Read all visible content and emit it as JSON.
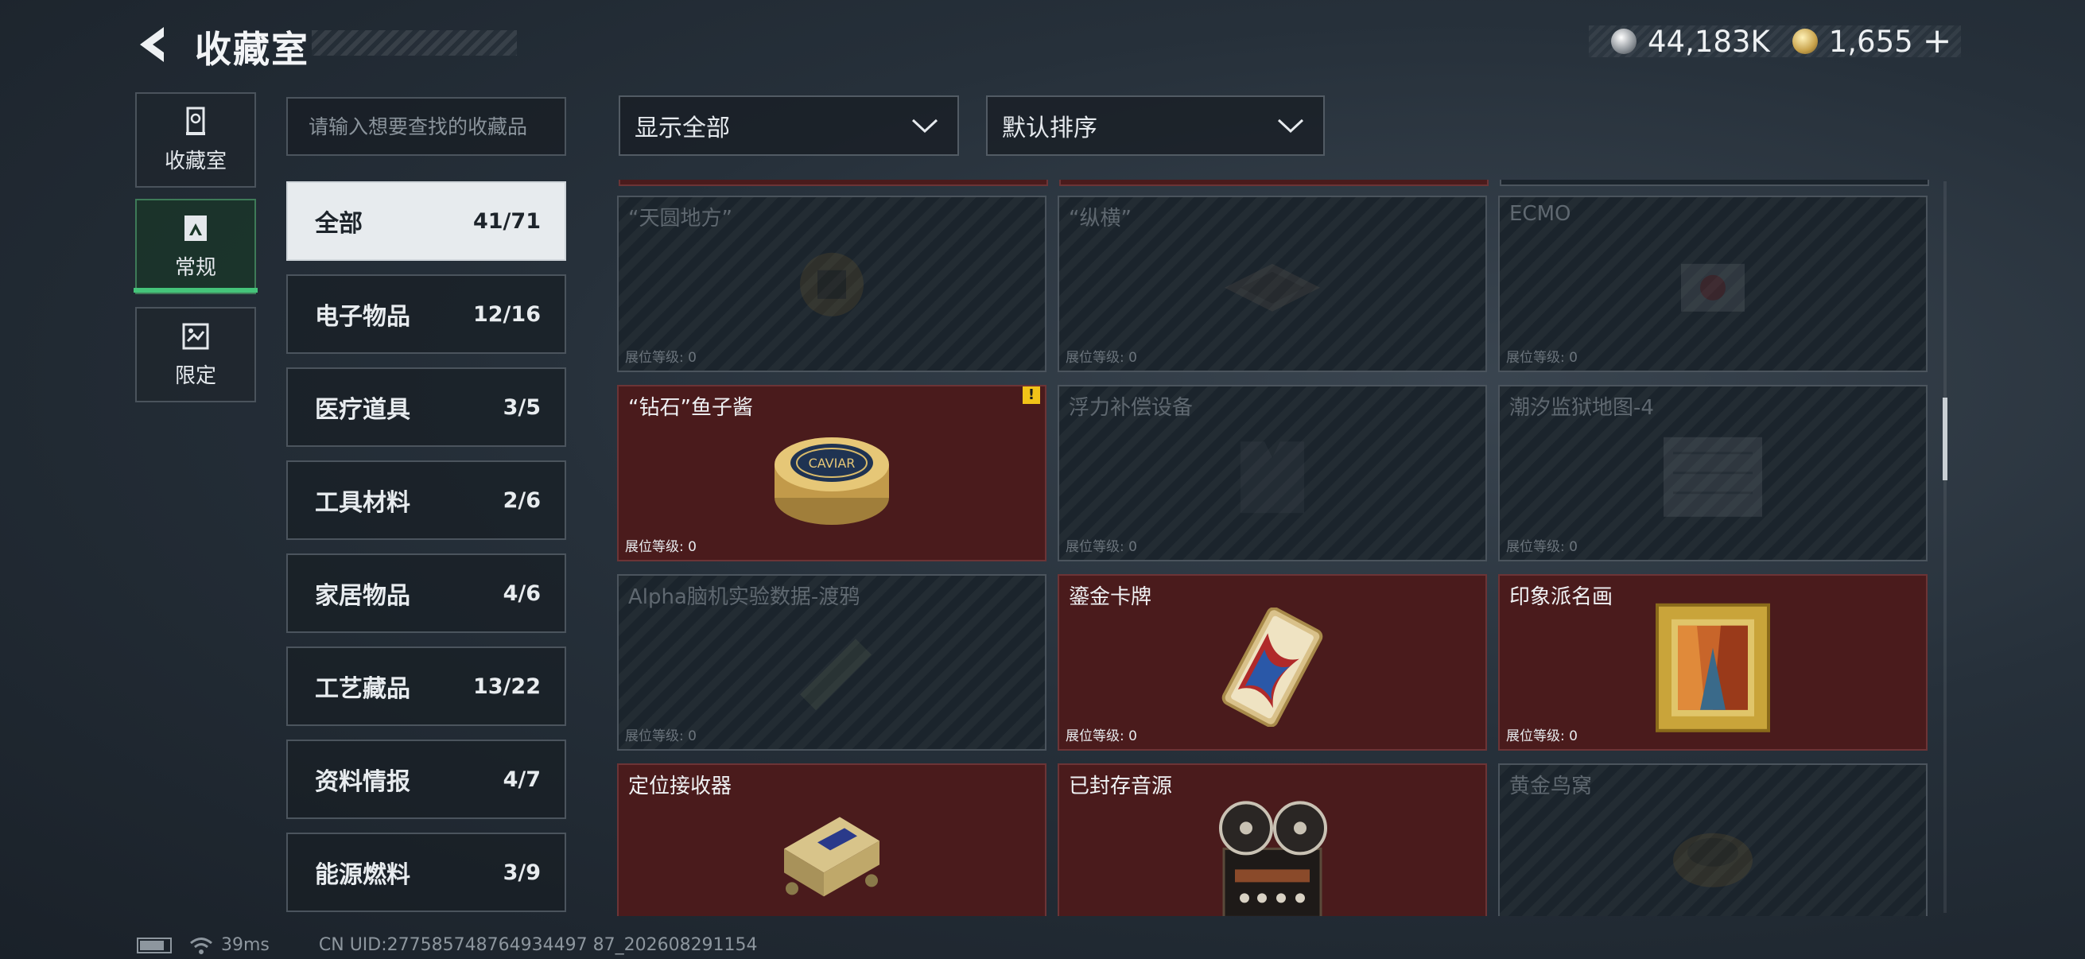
{
  "header": {
    "title": "收藏室"
  },
  "currency": {
    "silver": "44,183K",
    "gold": "1,655"
  },
  "nav": [
    {
      "label": "收藏室",
      "icon": "trophy-case-icon"
    },
    {
      "label": "常规",
      "icon": "picture-icon"
    },
    {
      "label": "限定",
      "icon": "limited-icon"
    }
  ],
  "search": {
    "placeholder": "请输入想要查找的收藏品"
  },
  "categories": [
    {
      "name": "全部",
      "count": "41/71"
    },
    {
      "name": "电子物品",
      "count": "12/16"
    },
    {
      "name": "医疗道具",
      "count": "3/5"
    },
    {
      "name": "工具材料",
      "count": "2/6"
    },
    {
      "name": "家居物品",
      "count": "4/6"
    },
    {
      "name": "工艺藏品",
      "count": "13/22"
    },
    {
      "name": "资料情报",
      "count": "4/7"
    },
    {
      "name": "能源燃料",
      "count": "3/9"
    }
  ],
  "filters": {
    "show": "显示全部",
    "sort": "默认排序"
  },
  "level_label": "展位等级: 0",
  "items": [
    {
      "name": "“天圆地方”",
      "owned": false,
      "icon": "compass-plate-icon"
    },
    {
      "name": "“纵横”",
      "owned": false,
      "icon": "board-game-icon"
    },
    {
      "name": "ECMO",
      "owned": false,
      "icon": "ecmo-device-icon"
    },
    {
      "name": "“钻石”鱼子酱",
      "owned": true,
      "icon": "caviar-tin-icon",
      "warning": "!"
    },
    {
      "name": "浮力补偿设备",
      "owned": false,
      "icon": "buoyancy-vest-icon"
    },
    {
      "name": "潮汐监狱地图-4",
      "owned": false,
      "icon": "map-icon"
    },
    {
      "name": "Alpha脑机实验数据-渡鸦",
      "owned": false,
      "icon": "data-drive-icon"
    },
    {
      "name": "鎏金卡牌",
      "owned": true,
      "icon": "gilded-card-icon"
    },
    {
      "name": "印象派名画",
      "owned": true,
      "icon": "painting-icon"
    },
    {
      "name": "定位接收器",
      "owned": true,
      "icon": "receiver-icon"
    },
    {
      "name": "已封存音源",
      "owned": true,
      "icon": "reel-recorder-icon"
    },
    {
      "name": "黄金鸟窝",
      "owned": false,
      "icon": "bird-nest-icon"
    }
  ],
  "footer": {
    "ping": "39ms",
    "uid": "CN UID:277585748764934497 87_202608291154"
  },
  "colors": {
    "owned_card": "#4a1b1c",
    "locked_card": "#1b242c",
    "accent_green": "#45c47a",
    "warning": "#f2c318"
  }
}
